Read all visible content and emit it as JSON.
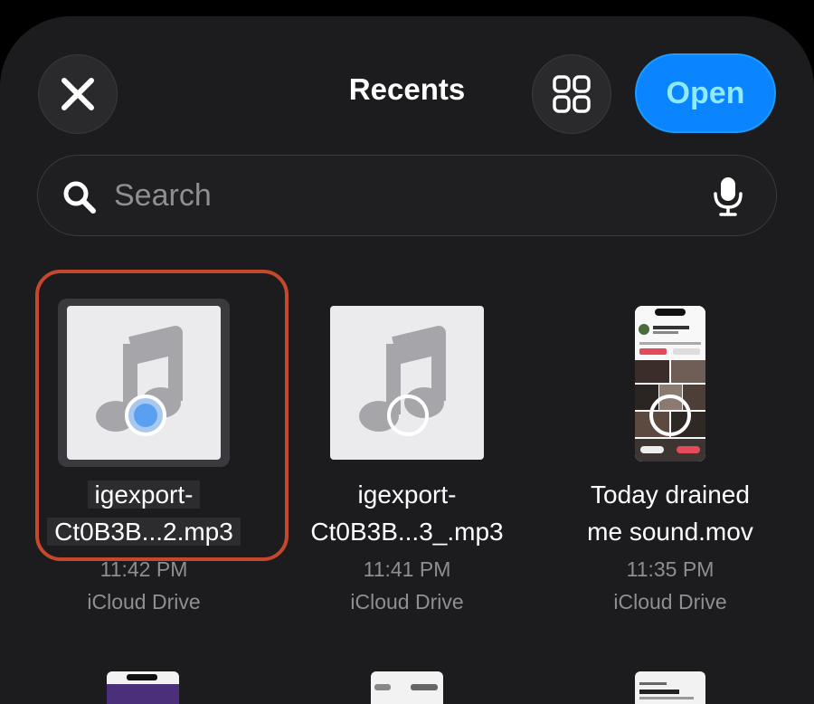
{
  "header": {
    "title": "Recents",
    "open_label": "Open"
  },
  "search": {
    "placeholder": "Search"
  },
  "files": [
    {
      "name_line1": "igexport-",
      "name_line2": "Ct0B3B...2.mp3",
      "time": "11:42 PM",
      "location": "iCloud Drive",
      "selected": true,
      "kind": "audio"
    },
    {
      "name_line1": "igexport-",
      "name_line2": "Ct0B3B...3_.mp3",
      "time": "11:41 PM",
      "location": "iCloud Drive",
      "selected": false,
      "kind": "audio"
    },
    {
      "name_line1": "Today drained",
      "name_line2": "me sound.mov",
      "time": "11:35 PM",
      "location": "iCloud Drive",
      "selected": false,
      "kind": "video"
    }
  ],
  "colors": {
    "accent": "#0a84ff",
    "selection_frame": "#c4492c"
  },
  "icons": [
    "close-icon",
    "grid-view-icon",
    "search-icon",
    "microphone-icon",
    "music-note-icon",
    "selection-circle-icon"
  ]
}
